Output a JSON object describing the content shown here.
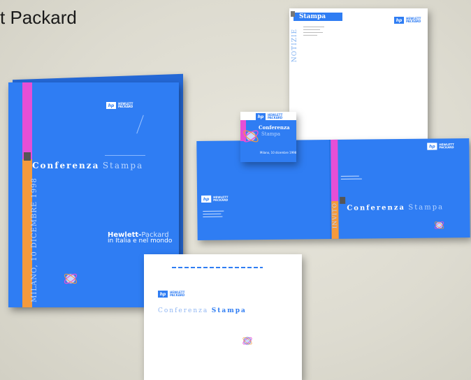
{
  "headline": "t Packard",
  "brand": {
    "mark": "hp",
    "line1": "HEWLETT",
    "line2": "PACKARD"
  },
  "folder": {
    "title_a": "Conferenza",
    "title_b": "Stampa",
    "side_text": "MILANO, 10 DICEMBRE 1998",
    "company_a": "Hewlett-",
    "company_b": "Packard",
    "tagline": "in Italia e nel mondo"
  },
  "letterhead": {
    "title": "Stampa",
    "side_text": "NOTIZIE"
  },
  "cd_label": {
    "title_a": "Conferenza",
    "title_b": "Stampa",
    "footer": "Milano, 10 dicembre 1998"
  },
  "open_folder": {
    "title_a": "Conferenza",
    "title_b": "Stampa",
    "side_text": "INVITO"
  },
  "invite_card": {
    "title_a": "Conferenza",
    "title_b": "Stampa"
  },
  "colors": {
    "blue": "#2f7df3",
    "magenta": "#e64fd6",
    "orange": "#f59a3c"
  }
}
